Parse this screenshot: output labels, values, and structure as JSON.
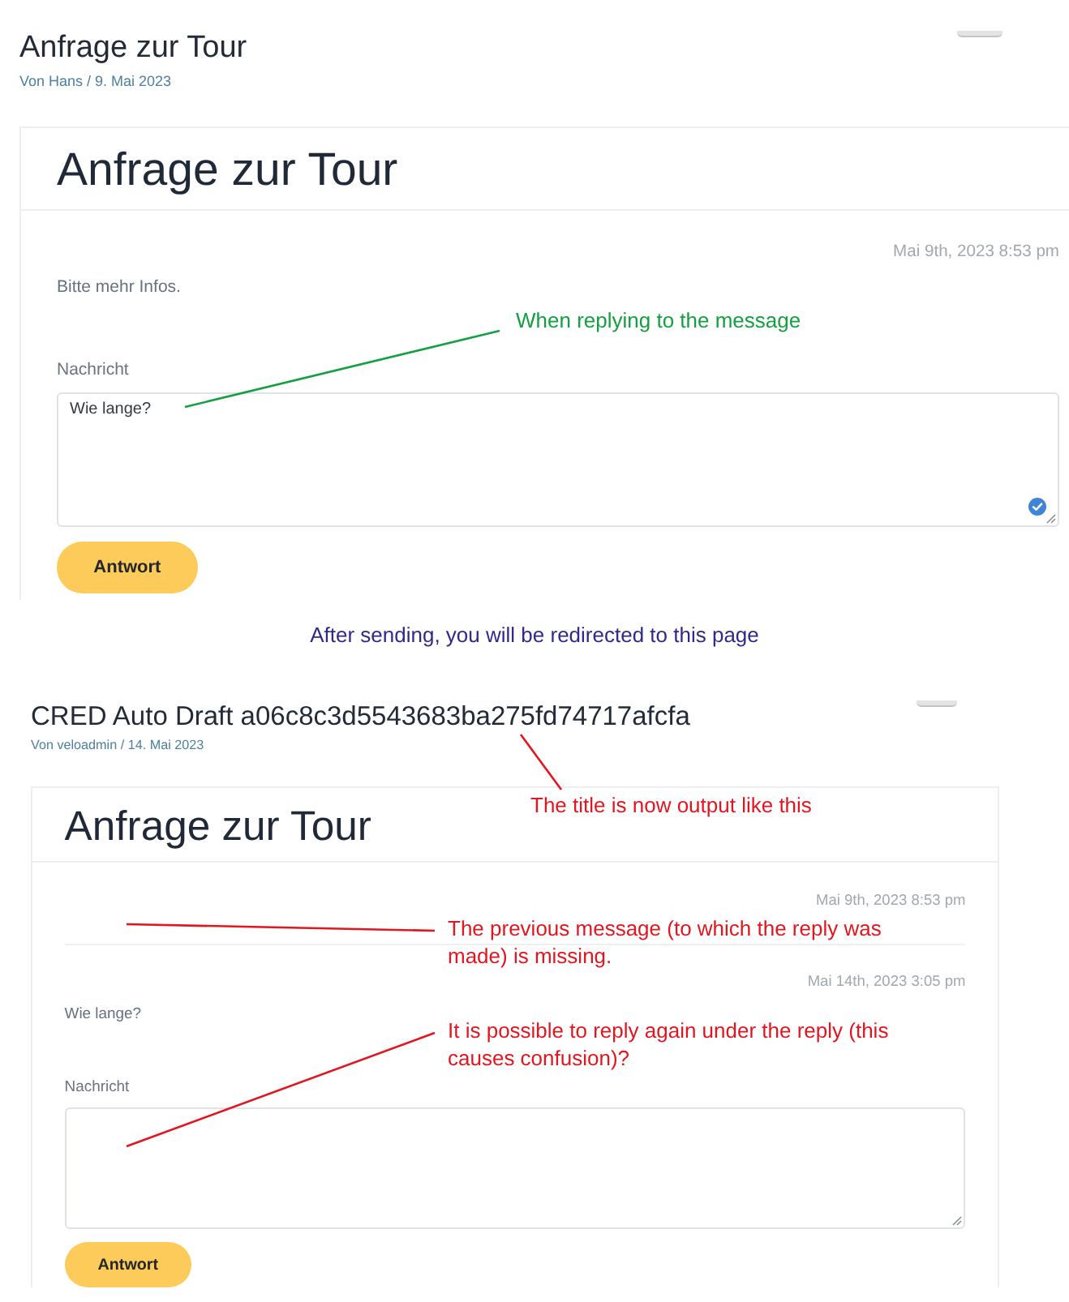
{
  "before": {
    "page_title": "Anfrage zur Tour",
    "meta": "Von Hans / 9. Mai 2023",
    "card": {
      "heading": "Anfrage zur Tour",
      "messages": [
        {
          "timestamp": "Mai 9th, 2023 8:53 pm",
          "text": "Bitte mehr Infos."
        }
      ],
      "form": {
        "label": "Nachricht",
        "value": "Wie lange?",
        "check_badge": true,
        "button": "Antwort"
      }
    },
    "annotations": [
      {
        "text": "When replying to the message",
        "color": "#14a040"
      }
    ]
  },
  "caption": "After sending, you will be redirected to this page",
  "after": {
    "page_title": "CRED Auto Draft a06c8c3d5543683ba275fd74717afcfa",
    "meta": "Von veloadmin / 14. Mai 2023",
    "card": {
      "heading": "Anfrage zur Tour",
      "messages": [
        {
          "timestamp": "Mai 9th, 2023 8:53 pm"
        },
        {
          "timestamp": "Mai 14th, 2023 3:05 pm",
          "text": "Wie lange?"
        }
      ],
      "form": {
        "label": "Nachricht",
        "button": "Antwort"
      }
    },
    "annotations": [
      {
        "text": "The title is now output like this",
        "color": "#e3151f"
      },
      {
        "text": "The previous message (to which the reply was made) is missing.",
        "color": "#e3151f"
      },
      {
        "text": "It is possible to reply again under the reply (this causes confusion)?",
        "color": "#e3151f"
      }
    ]
  }
}
